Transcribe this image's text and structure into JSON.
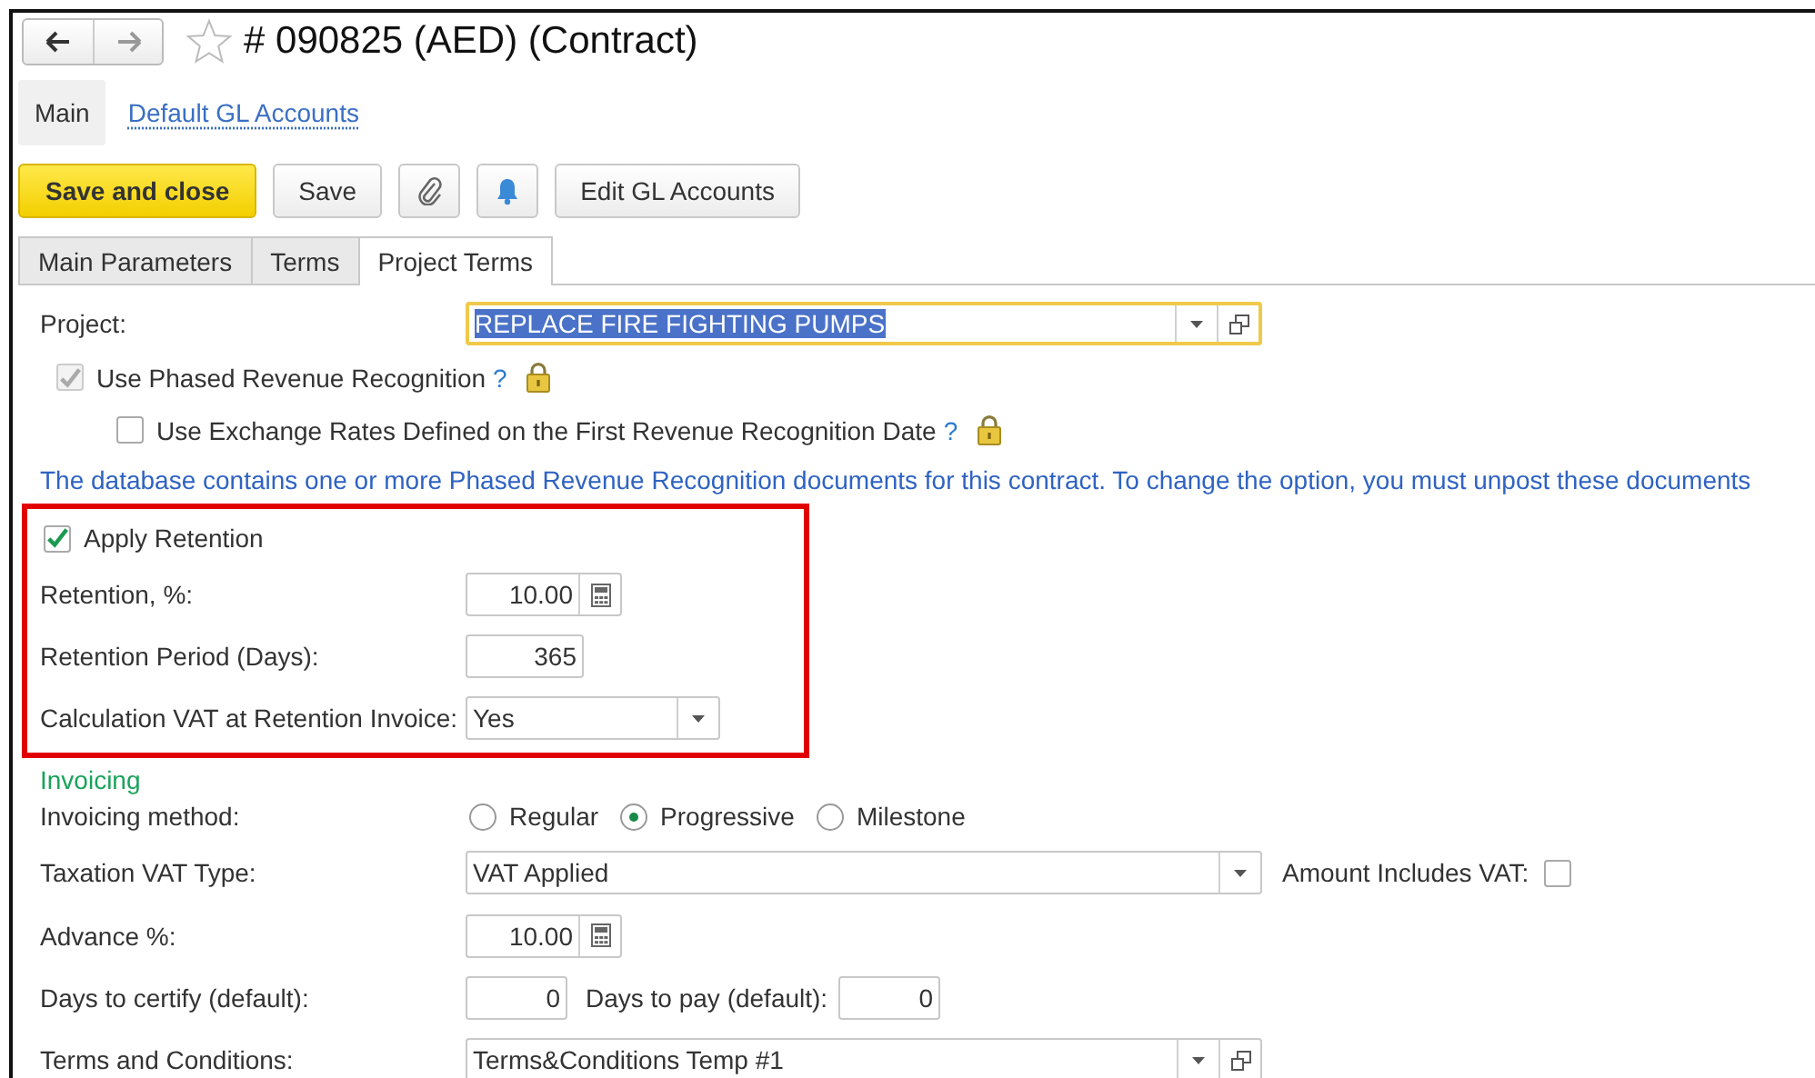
{
  "window": {
    "title": "# 090825 (AED) (Contract)",
    "favorite": false
  },
  "sections": [
    {
      "label": "Main",
      "selected": true
    },
    {
      "label": "Default GL Accounts",
      "selected": false
    }
  ],
  "toolbar": [
    {
      "kind": "primary",
      "label": "Save and close"
    },
    {
      "kind": "text",
      "label": "Save"
    },
    {
      "kind": "attach"
    },
    {
      "kind": "notify"
    },
    {
      "kind": "text",
      "label": "Edit GL Accounts"
    }
  ],
  "tabs": [
    {
      "label": "Main Parameters",
      "selected": false
    },
    {
      "label": "Terms",
      "selected": false
    },
    {
      "label": "Project Terms",
      "selected": true
    }
  ],
  "project": {
    "label": "Project:",
    "value": "REPLACE FIRE FIGHTING PUMPS",
    "focused": true
  },
  "options": [
    {
      "label": "Use Phased Revenue Recognition",
      "checked": true,
      "disabled": true,
      "help": "?",
      "locked": true,
      "children": [
        {
          "label": "Use Exchange Rates Defined on the First Revenue Recognition Date",
          "checked": false,
          "disabled": false,
          "help": "?",
          "locked": true
        }
      ]
    }
  ],
  "notice": "The database contains one or more Phased Revenue Recognition documents for this contract. To change the option, you must unpost these documents",
  "retention": {
    "highlighted": true,
    "apply": {
      "label": "Apply Retention",
      "checked": true
    },
    "percent": {
      "label": "Retention, %:",
      "value": "10.00"
    },
    "period": {
      "label": "Retention Period (Days):",
      "value": "365"
    },
    "vat": {
      "label": "Calculation VAT at Retention Invoice:",
      "value": "Yes"
    }
  },
  "invoicing": {
    "heading": "Invoicing",
    "method": {
      "label": "Invoicing method:",
      "options": [
        {
          "label": "Regular",
          "selected": false
        },
        {
          "label": "Progressive",
          "selected": true
        },
        {
          "label": "Milestone",
          "selected": false
        }
      ]
    },
    "vat_type": {
      "label": "Taxation VAT Type:",
      "value": "VAT Applied"
    },
    "includes_vat": {
      "label": "Amount Includes VAT:",
      "checked": false
    },
    "advance": {
      "label": "Advance %:",
      "value": "10.00"
    },
    "days_certify": {
      "label": "Days to certify (default):",
      "value": "0"
    },
    "days_pay": {
      "label": "Days to pay (default):",
      "value": "0"
    },
    "terms": {
      "label": "Terms and Conditions:",
      "value": "Terms&Conditions Temp #1"
    }
  }
}
